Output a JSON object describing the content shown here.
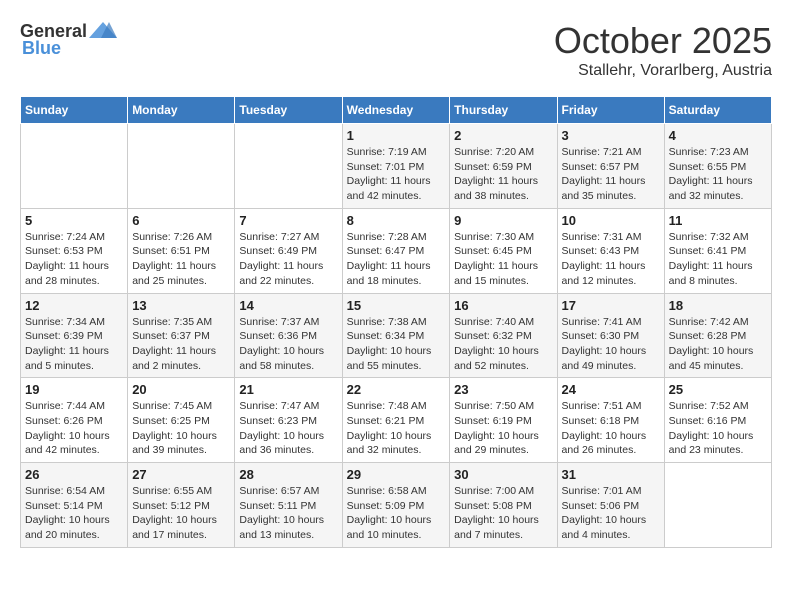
{
  "header": {
    "logo_general": "General",
    "logo_blue": "Blue",
    "month": "October 2025",
    "location": "Stallehr, Vorarlberg, Austria"
  },
  "weekdays": [
    "Sunday",
    "Monday",
    "Tuesday",
    "Wednesday",
    "Thursday",
    "Friday",
    "Saturday"
  ],
  "weeks": [
    [
      {
        "day": "",
        "info": ""
      },
      {
        "day": "",
        "info": ""
      },
      {
        "day": "",
        "info": ""
      },
      {
        "day": "1",
        "info": "Sunrise: 7:19 AM\nSunset: 7:01 PM\nDaylight: 11 hours and 42 minutes."
      },
      {
        "day": "2",
        "info": "Sunrise: 7:20 AM\nSunset: 6:59 PM\nDaylight: 11 hours and 38 minutes."
      },
      {
        "day": "3",
        "info": "Sunrise: 7:21 AM\nSunset: 6:57 PM\nDaylight: 11 hours and 35 minutes."
      },
      {
        "day": "4",
        "info": "Sunrise: 7:23 AM\nSunset: 6:55 PM\nDaylight: 11 hours and 32 minutes."
      }
    ],
    [
      {
        "day": "5",
        "info": "Sunrise: 7:24 AM\nSunset: 6:53 PM\nDaylight: 11 hours and 28 minutes."
      },
      {
        "day": "6",
        "info": "Sunrise: 7:26 AM\nSunset: 6:51 PM\nDaylight: 11 hours and 25 minutes."
      },
      {
        "day": "7",
        "info": "Sunrise: 7:27 AM\nSunset: 6:49 PM\nDaylight: 11 hours and 22 minutes."
      },
      {
        "day": "8",
        "info": "Sunrise: 7:28 AM\nSunset: 6:47 PM\nDaylight: 11 hours and 18 minutes."
      },
      {
        "day": "9",
        "info": "Sunrise: 7:30 AM\nSunset: 6:45 PM\nDaylight: 11 hours and 15 minutes."
      },
      {
        "day": "10",
        "info": "Sunrise: 7:31 AM\nSunset: 6:43 PM\nDaylight: 11 hours and 12 minutes."
      },
      {
        "day": "11",
        "info": "Sunrise: 7:32 AM\nSunset: 6:41 PM\nDaylight: 11 hours and 8 minutes."
      }
    ],
    [
      {
        "day": "12",
        "info": "Sunrise: 7:34 AM\nSunset: 6:39 PM\nDaylight: 11 hours and 5 minutes."
      },
      {
        "day": "13",
        "info": "Sunrise: 7:35 AM\nSunset: 6:37 PM\nDaylight: 11 hours and 2 minutes."
      },
      {
        "day": "14",
        "info": "Sunrise: 7:37 AM\nSunset: 6:36 PM\nDaylight: 10 hours and 58 minutes."
      },
      {
        "day": "15",
        "info": "Sunrise: 7:38 AM\nSunset: 6:34 PM\nDaylight: 10 hours and 55 minutes."
      },
      {
        "day": "16",
        "info": "Sunrise: 7:40 AM\nSunset: 6:32 PM\nDaylight: 10 hours and 52 minutes."
      },
      {
        "day": "17",
        "info": "Sunrise: 7:41 AM\nSunset: 6:30 PM\nDaylight: 10 hours and 49 minutes."
      },
      {
        "day": "18",
        "info": "Sunrise: 7:42 AM\nSunset: 6:28 PM\nDaylight: 10 hours and 45 minutes."
      }
    ],
    [
      {
        "day": "19",
        "info": "Sunrise: 7:44 AM\nSunset: 6:26 PM\nDaylight: 10 hours and 42 minutes."
      },
      {
        "day": "20",
        "info": "Sunrise: 7:45 AM\nSunset: 6:25 PM\nDaylight: 10 hours and 39 minutes."
      },
      {
        "day": "21",
        "info": "Sunrise: 7:47 AM\nSunset: 6:23 PM\nDaylight: 10 hours and 36 minutes."
      },
      {
        "day": "22",
        "info": "Sunrise: 7:48 AM\nSunset: 6:21 PM\nDaylight: 10 hours and 32 minutes."
      },
      {
        "day": "23",
        "info": "Sunrise: 7:50 AM\nSunset: 6:19 PM\nDaylight: 10 hours and 29 minutes."
      },
      {
        "day": "24",
        "info": "Sunrise: 7:51 AM\nSunset: 6:18 PM\nDaylight: 10 hours and 26 minutes."
      },
      {
        "day": "25",
        "info": "Sunrise: 7:52 AM\nSunset: 6:16 PM\nDaylight: 10 hours and 23 minutes."
      }
    ],
    [
      {
        "day": "26",
        "info": "Sunrise: 6:54 AM\nSunset: 5:14 PM\nDaylight: 10 hours and 20 minutes."
      },
      {
        "day": "27",
        "info": "Sunrise: 6:55 AM\nSunset: 5:12 PM\nDaylight: 10 hours and 17 minutes."
      },
      {
        "day": "28",
        "info": "Sunrise: 6:57 AM\nSunset: 5:11 PM\nDaylight: 10 hours and 13 minutes."
      },
      {
        "day": "29",
        "info": "Sunrise: 6:58 AM\nSunset: 5:09 PM\nDaylight: 10 hours and 10 minutes."
      },
      {
        "day": "30",
        "info": "Sunrise: 7:00 AM\nSunset: 5:08 PM\nDaylight: 10 hours and 7 minutes."
      },
      {
        "day": "31",
        "info": "Sunrise: 7:01 AM\nSunset: 5:06 PM\nDaylight: 10 hours and 4 minutes."
      },
      {
        "day": "",
        "info": ""
      }
    ]
  ]
}
